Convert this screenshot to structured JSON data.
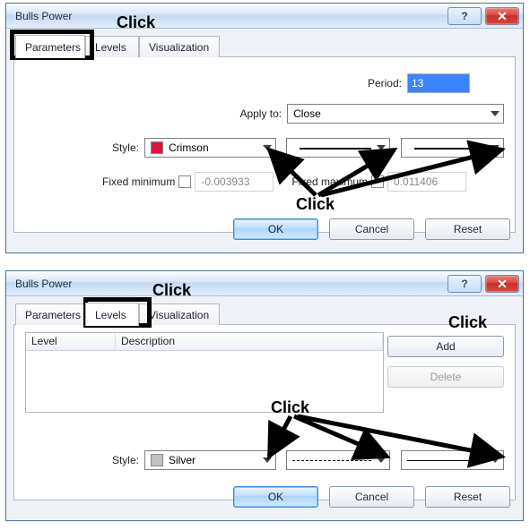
{
  "dialog1": {
    "title": "Bulls Power",
    "help": "?",
    "tabs": {
      "parameters": "Parameters",
      "levels": "Levels",
      "visualization": "Visualization"
    },
    "period_label": "Period:",
    "period_value": "13",
    "apply_label": "Apply to:",
    "apply_value": "Close",
    "style_label": "Style:",
    "style_value": "Crimson",
    "fixmin_label": "Fixed minimum",
    "fixmin_value": "-0.003933",
    "fixmax_label": "Fixed maximum",
    "fixmax_value": "0.011406",
    "ok": "OK",
    "cancel": "Cancel",
    "reset": "Reset"
  },
  "dialog2": {
    "title": "Bulls Power",
    "help": "?",
    "tabs": {
      "parameters": "Parameters",
      "levels": "Levels",
      "visualization": "Visualization"
    },
    "col_level": "Level",
    "col_desc": "Description",
    "add": "Add",
    "delete": "Delete",
    "style_label": "Style:",
    "style_value": "Silver",
    "ok": "OK",
    "cancel": "Cancel",
    "reset": "Reset"
  },
  "anno": {
    "click": "Click"
  }
}
